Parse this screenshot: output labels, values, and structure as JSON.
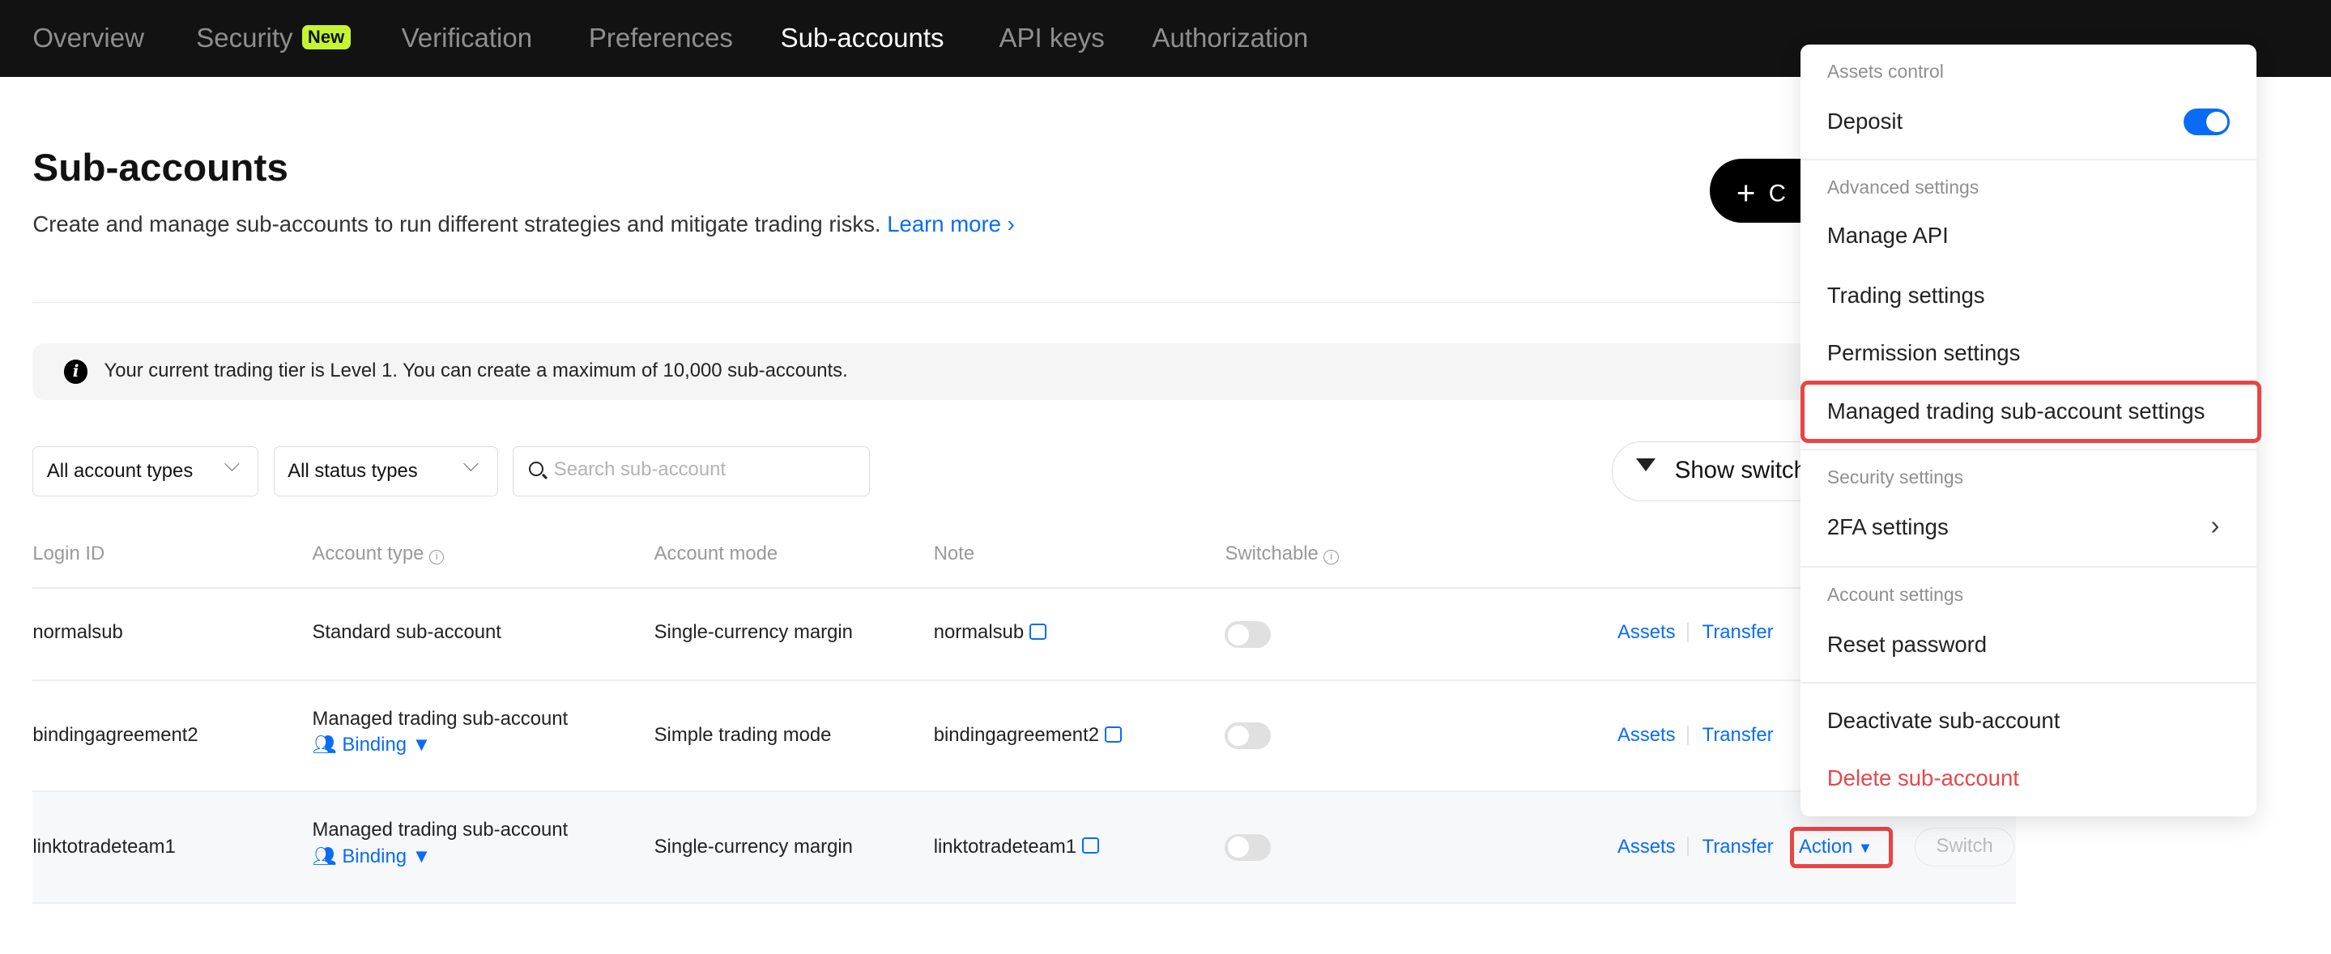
{
  "nav": {
    "items": [
      {
        "label": "Overview"
      },
      {
        "label": "Security",
        "badge": "New"
      },
      {
        "label": "Verification"
      },
      {
        "label": "Preferences"
      },
      {
        "label": "Sub-accounts",
        "active": true
      },
      {
        "label": "API keys"
      },
      {
        "label": "Authorization"
      }
    ]
  },
  "header": {
    "title": "Sub-accounts",
    "subtitle": "Create and manage sub-accounts to run different strategies and mitigate trading risks.",
    "learn_more": "Learn more",
    "create_label": "C"
  },
  "banner": {
    "text": "Your current trading tier is Level 1. You can create a maximum of 10,000 sub-accounts."
  },
  "filters": {
    "account_type": "All account types",
    "status_type": "All status types",
    "search_placeholder": "Search sub-account",
    "show_switch": "Show switch"
  },
  "table": {
    "headers": [
      "Login ID",
      "Account type",
      "Account mode",
      "Note",
      "Switchable"
    ],
    "rows": [
      {
        "login_id": "normalsub",
        "account_type": "Standard sub-account",
        "binding": "",
        "mode": "Single-currency margin",
        "note": "normalsub",
        "switchable": false
      },
      {
        "login_id": "bindingagreement2",
        "account_type": "Managed trading sub-account",
        "binding": "Binding",
        "mode": "Simple trading mode",
        "note": "bindingagreement2",
        "switchable": false
      },
      {
        "login_id": "linktotradeteam1",
        "account_type": "Managed trading sub-account",
        "binding": "Binding",
        "mode": "Single-currency margin",
        "note": "linktotradeteam1",
        "switchable": false
      }
    ],
    "actions": {
      "assets": "Assets",
      "transfer": "Transfer",
      "action": "Action",
      "switch": "Switch"
    }
  },
  "menu": {
    "assets_control": "Assets control",
    "deposit": "Deposit",
    "deposit_enabled": true,
    "advanced_settings": "Advanced settings",
    "manage_api": "Manage API",
    "trading_settings": "Trading settings",
    "permission_settings": "Permission settings",
    "managed_settings": "Managed trading sub-account settings",
    "security_settings": "Security settings",
    "twofa": "2FA settings",
    "account_settings": "Account settings",
    "reset_password": "Reset password",
    "deactivate": "Deactivate sub-account",
    "delete": "Delete sub-account"
  },
  "colors": {
    "accent": "#0a6cf5",
    "danger": "#e5484d",
    "highlight": "#e84545",
    "badge": "#c6f432",
    "nav_bg": "#121212"
  }
}
